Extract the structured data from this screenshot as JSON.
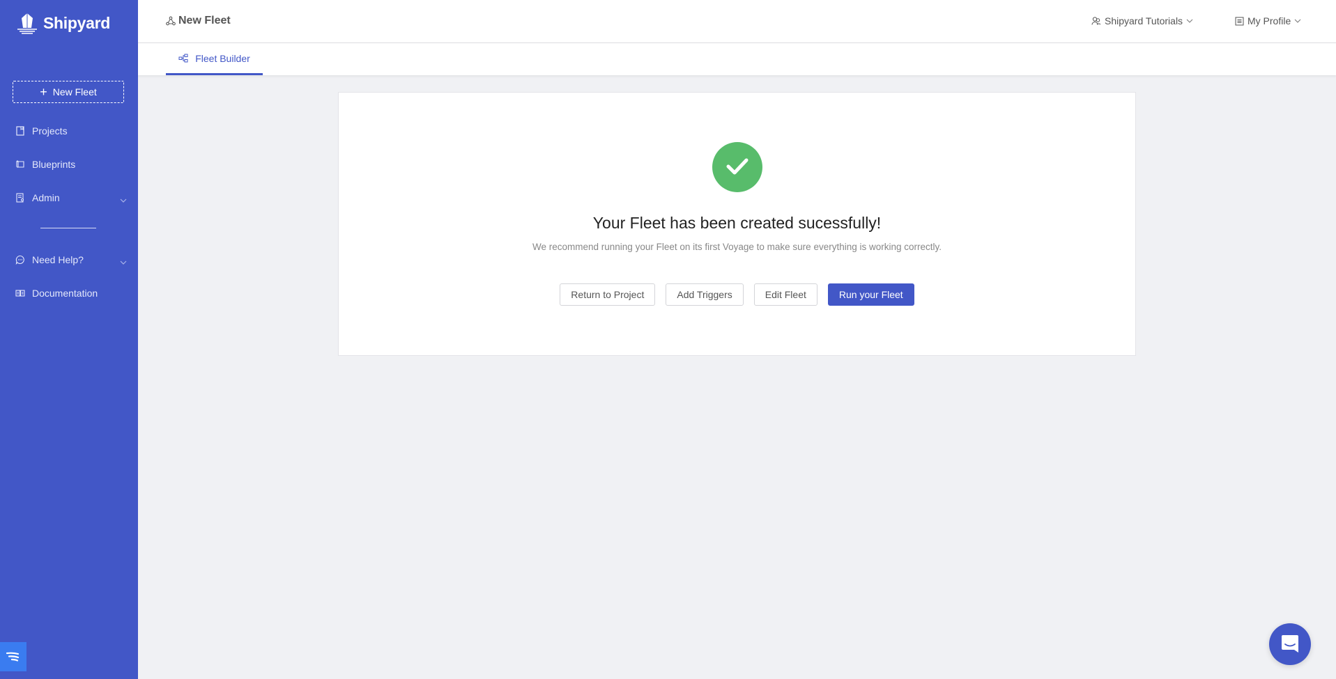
{
  "app": {
    "brand": "Shipyard"
  },
  "sidebar": {
    "new_fleet_label": "New Fleet",
    "items": [
      {
        "label": "Projects",
        "icon": "book-icon"
      },
      {
        "label": "Blueprints",
        "icon": "scroll-icon"
      },
      {
        "label": "Admin",
        "icon": "admin-icon",
        "has_dropdown": true
      },
      {
        "label": "Need Help?",
        "icon": "chat-bubble-icon",
        "has_dropdown": true
      },
      {
        "label": "Documentation",
        "icon": "open-book-icon"
      }
    ]
  },
  "header": {
    "title": "New Fleet",
    "org_menu": "Shipyard Tutorials",
    "profile_menu": "My Profile"
  },
  "tabs": [
    {
      "label": "Fleet Builder",
      "active": true
    }
  ],
  "main": {
    "headline": "Your Fleet has been created sucessfully!",
    "subtext": "We recommend running your Fleet on its first Voyage to make sure everything is working correctly.",
    "buttons": {
      "return": "Return to Project",
      "triggers": "Add Triggers",
      "edit": "Edit Fleet",
      "run": "Run your Fleet"
    }
  },
  "colors": {
    "brand": "#4257c7",
    "success": "#58bc6b"
  }
}
